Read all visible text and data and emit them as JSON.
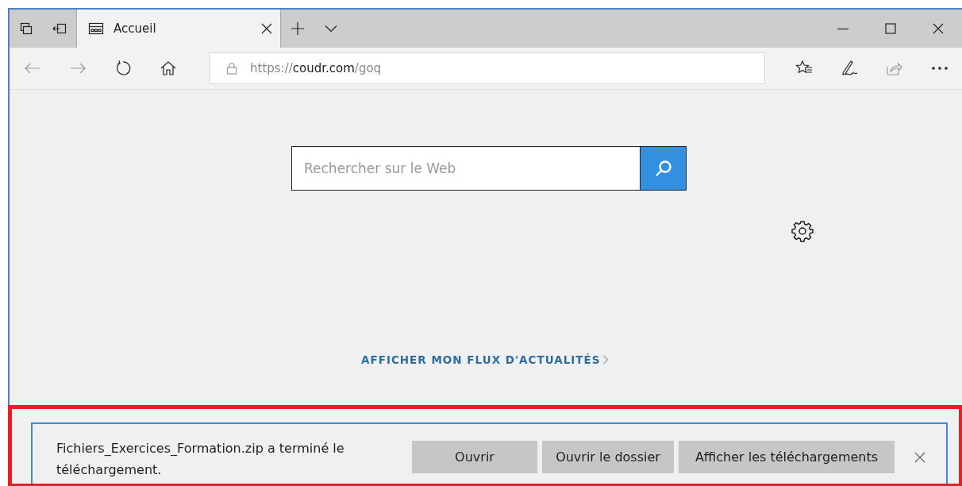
{
  "tabs": [
    {
      "title": "Accueil",
      "selected": true
    }
  ],
  "address": {
    "scheme": "https://",
    "host": "coudr.com",
    "path": "/goq"
  },
  "search": {
    "placeholder": "Rechercher sur le Web"
  },
  "news_link": {
    "label": "AFFICHER MON FLUX D'ACTUALITÉS"
  },
  "download_bar": {
    "message": "Fichiers_Exercices_Formation.zip a terminé le téléchargement.",
    "buttons": [
      "Ouvrir",
      "Ouvrir le dossier",
      "Afficher les téléchargements"
    ]
  }
}
